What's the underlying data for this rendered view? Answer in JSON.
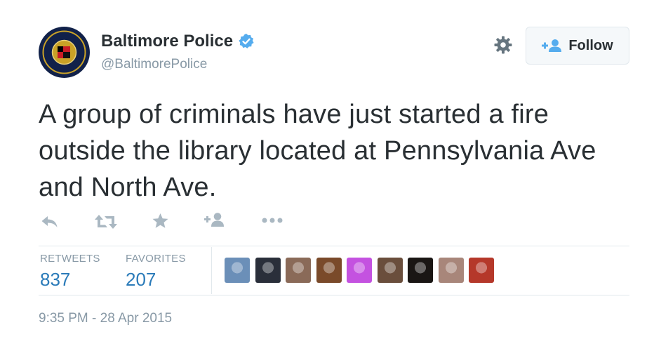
{
  "user": {
    "display_name": "Baltimore Police",
    "screen_name": "@BaltimorePolice",
    "verified": true,
    "avatar_icon": "police-badge-avatar"
  },
  "header": {
    "settings_icon": "gear-icon",
    "follow_label": "Follow"
  },
  "tweet": {
    "text": "A group of criminals have just started a fire outside the library located at Pennsylvania Ave and North Ave."
  },
  "actions": [
    {
      "name": "reply",
      "icon": "reply-icon"
    },
    {
      "name": "retweet",
      "icon": "retweet-icon"
    },
    {
      "name": "favorite",
      "icon": "star-icon"
    },
    {
      "name": "follow",
      "icon": "add-user-icon"
    },
    {
      "name": "more",
      "icon": "more-dots-icon"
    }
  ],
  "stats": {
    "retweets_label": "RETWEETS",
    "retweets_count": "837",
    "favorites_label": "FAVORITES",
    "favorites_count": "207"
  },
  "favorited_by": [
    {
      "name": "user-avatar-1",
      "color": "#6b8fb8"
    },
    {
      "name": "user-avatar-2",
      "color": "#2a2f3a"
    },
    {
      "name": "user-avatar-3",
      "color": "#8a6a58"
    },
    {
      "name": "user-avatar-4",
      "color": "#7a4a2a"
    },
    {
      "name": "user-avatar-5",
      "color": "#c452e0"
    },
    {
      "name": "user-avatar-6",
      "color": "#6a4e3c"
    },
    {
      "name": "user-avatar-7",
      "color": "#1a1614"
    },
    {
      "name": "user-avatar-8",
      "color": "#a8867a"
    },
    {
      "name": "user-avatar-9",
      "color": "#b5382a"
    }
  ],
  "timestamp": "9:35 PM - 28 Apr 2015",
  "colors": {
    "link": "#2b7bb9",
    "muted": "#8899a6",
    "text": "#292f33",
    "verified": "#55acee",
    "icon": "#aab8c2"
  }
}
